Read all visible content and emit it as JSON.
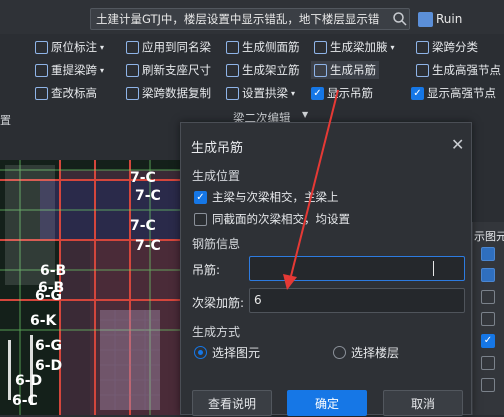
{
  "topbar": {
    "search_text": "土建计量GTJ中，楼层设置中显示错乱，地下楼层显示错",
    "user_name": "Ruin"
  },
  "ribbon": {
    "items": [
      "原位标注",
      "应用到同名梁",
      "生成侧面筋",
      "生成梁加腋",
      "梁跨分类",
      "重提梁跨",
      "刷新支座尺寸",
      "生成架立筋",
      "生成吊筋",
      "生成高强节点",
      "查改标高",
      "梁跨数据复制",
      "设置拱梁",
      "显示吊筋",
      "显示高强节点"
    ],
    "group_label": "梁二次编辑"
  },
  "left_mark": "置",
  "canvas": {
    "labels": [
      "7-C",
      "7-C",
      "7-C",
      "7-C",
      "6-B",
      "6-G",
      "6-K",
      "6-B",
      "6-G",
      "6-D",
      "6-C",
      "6-D"
    ]
  },
  "right_panel": {
    "title": "示图元"
  },
  "dialog": {
    "title": "生成吊筋",
    "section_position": "生成位置",
    "opt_main_secondary": "主梁与次梁相交，主梁上",
    "opt_same_section": "同截面的次梁相交，均设置",
    "section_rebar": "钢筋信息",
    "label_hanger": "吊筋:",
    "hanger_value": "",
    "label_secondary": "次梁加筋:",
    "secondary_value": "6",
    "section_method": "生成方式",
    "radio_select_elements": "选择图元",
    "radio_select_floors": "选择楼层",
    "btn_help": "查看说明",
    "btn_ok": "确定",
    "btn_cancel": "取消"
  },
  "colors": {
    "accent": "#1677e6",
    "annotation_arrow": "#e53935"
  }
}
